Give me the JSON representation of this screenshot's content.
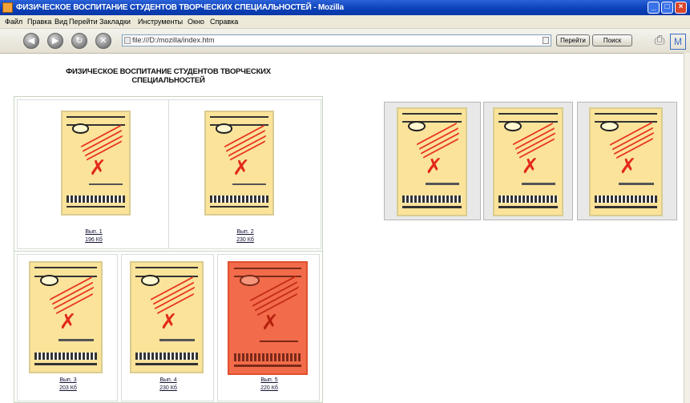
{
  "window": {
    "title": "ФИЗИЧЕСКОЕ ВОСПИТАНИЕ СТУДЕНТОВ ТВОРЧЕСКИХ СПЕЦИАЛЬНОСТЕЙ - Mozilla",
    "buttons": {
      "minimize": "_",
      "maximize": "□",
      "close": "×"
    }
  },
  "menu": {
    "items": [
      "Файл",
      "Правка",
      "Вид",
      "Перейти",
      "Закладки",
      "Инструменты",
      "Окно",
      "Справка"
    ]
  },
  "toolbar": {
    "back": "◀",
    "forward": "▶",
    "reload": "↻",
    "stop": "✕",
    "url": "file:///D:/mozilla/index.htm",
    "go_label": "Перейти",
    "search_label": "Поиск"
  },
  "content": {
    "heading_line1": "ФИЗИЧЕСКОЕ ВОСПИТАНИЕ СТУДЕНТОВ ТВОРЧЕСКИХ",
    "heading_line2": "СПЕЦИАЛЬНОСТЕЙ",
    "gallery": [
      {
        "num": "Вып. 1",
        "size": "196 Кб",
        "highlighted": false
      },
      {
        "num": "Вып. 2",
        "size": "230 Кб",
        "highlighted": false
      },
      {
        "num": "Вып. 3",
        "size": "203 Кб",
        "highlighted": false
      },
      {
        "num": "Вып. 4",
        "size": "230 Кб",
        "highlighted": false
      },
      {
        "num": "Вып. 5",
        "size": "220 Кб",
        "highlighted": true
      }
    ],
    "thumbnail_count": 3
  },
  "colors": {
    "cover_bg": "#fbe39a",
    "cover_highlight_bg": "#f26b4a",
    "accent_red": "#e8331f",
    "titlebar_blue": "#0a3fb6"
  }
}
